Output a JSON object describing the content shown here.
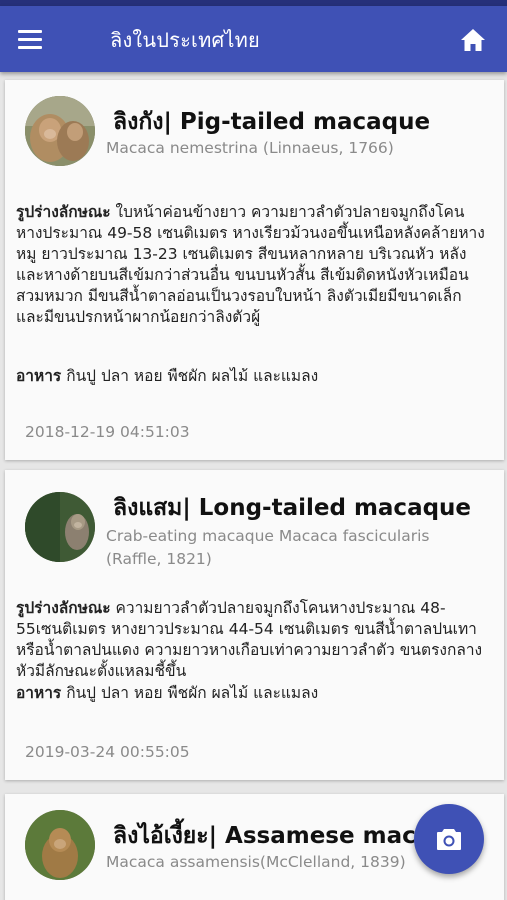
{
  "app": {
    "title": "ลิงในประเทศไทย"
  },
  "colors": {
    "primary": "#3f51b5",
    "status": "#26307a"
  },
  "icons": {
    "menu": "menu-icon",
    "home": "home-icon",
    "camera": "camera-icon"
  },
  "cards": [
    {
      "name": "ลิงกัง| Pig-tailed macaque",
      "scientific": "Macaca nemestrina (Linnaeus, 1766)",
      "desc_label": "รูปร่างลักษณะ",
      "desc": "ใบหน้าค่อนข้างยาว ความยาวลำตัวปลายจมูกถึงโคนหางประมาณ 49-58 เซนติเมตร  หางเรียวม้วนงอขึ้นเหนือหลังคล้ายหางหมู ยาวประมาณ 13-23 เซนติเมตร สีขนหลากหลาย บริเวณหัว หลัง และหางด้ายบนสีเข้มกว่าส่วนอื่น ขนบนหัวสั้น สีเข้มติดหนังหัวเหมือนสวมหมวก  มีขนสีน้ำตาลอ่อนเป็นวงรอบใบหน้า ลิงตัวเมียมีขนาดเล็กและมีขนปรกหน้าผากน้อยกว่าลิงตัวผู้",
      "food_label": "อาหาร",
      "food": "กินปู ปลา หอย พืชผัก ผลไม้ และแมลง",
      "timestamp": "2018-12-19 04:51:03"
    },
    {
      "name": "ลิงแสม| Long-tailed macaque",
      "scientific": "Crab-eating macaque  Macaca fascicularis (Raffle, 1821)",
      "desc_label": "รูปร่างลักษณะ",
      "desc": "ความยาวลำตัวปลายจมูกถึงโคนหางประมาณ 48-55เซนติเมตร  หางยาวประมาณ 44-54 เซนติเมตร ขนสีน้ำตาลปนเทาหรือน้ำตาลปนแดง ความยาวหางเกือบเท่าความยาวลำตัว ขนตรงกลางหัวมีลักษณะตั้งแหลมชี้ขึ้น",
      "food_label": "อาหาร",
      "food": "กินปู ปลา หอย พืชผัก ผลไม้ และแมลง",
      "timestamp": "2019-03-24 00:55:05"
    },
    {
      "name": "ลิงไอ้เงี้ยะ| Assamese macaque",
      "scientific": "Macaca assamensis(McClelland, 1839)"
    }
  ]
}
